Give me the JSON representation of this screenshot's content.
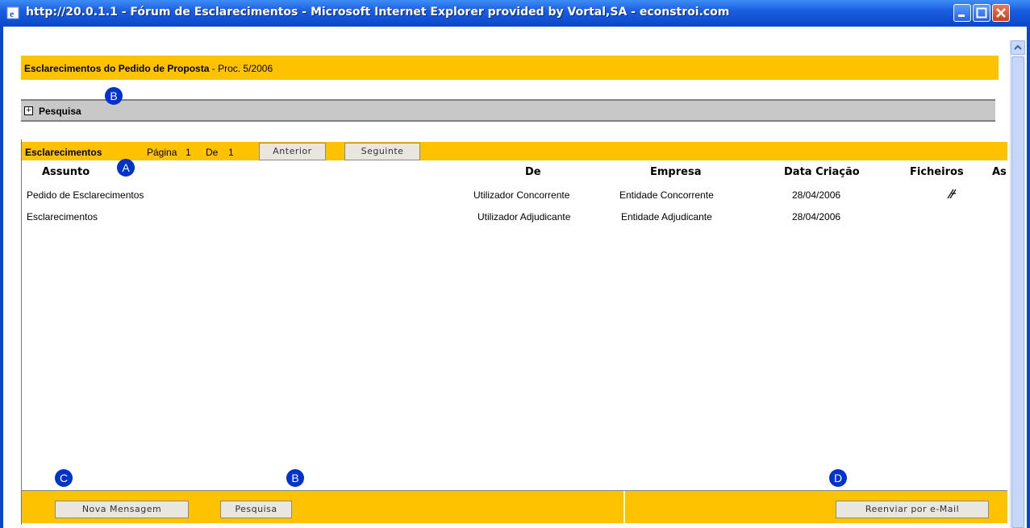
{
  "window": {
    "title": "http://20.0.1.1 - Fórum de Esclarecimentos - Microsoft Internet Explorer provided by Vortal,SA - econstroi.com",
    "controls": [
      "minimize-button",
      "maximize-button",
      "close-button"
    ]
  },
  "header": {
    "title": "Esclarecimentos do Pedido de Proposta",
    "proc": " - Proc. 5/2006"
  },
  "search": {
    "expand_icon": "+",
    "label": "Pesquisa"
  },
  "list": {
    "title": "Esclarecimentos",
    "page_label": "Página",
    "page_num": "1",
    "of_label": "De",
    "total_pages": "1",
    "prev_button": "Anterior",
    "next_button": "Seguinte"
  },
  "table": {
    "columns": [
      "Assunto",
      "De",
      "Empresa",
      "Data Criação",
      "Ficheiros",
      "As"
    ],
    "rows": [
      [
        "Pedido de Esclarecimentos",
        "Utilizador Concorrente",
        "Entidade Concorrente",
        "28/04/2006",
        "paperclip-icon",
        ""
      ],
      [
        "Esclarecimentos",
        "Utilizador Adjudicante",
        "Entidade Adjudicante",
        "28/04/2006",
        "",
        ""
      ]
    ]
  },
  "footer": {
    "new_message_button": "Nova Mensagem",
    "search_button": "Pesquisa",
    "resend_button": "Reenviar por e-Mail"
  },
  "badges": {
    "a": "A",
    "b": "B",
    "c": "C",
    "d": "D"
  },
  "colors": {
    "accent": "#ffc200",
    "badge": "#0033cc",
    "titlebar": "#1a5fe0"
  }
}
